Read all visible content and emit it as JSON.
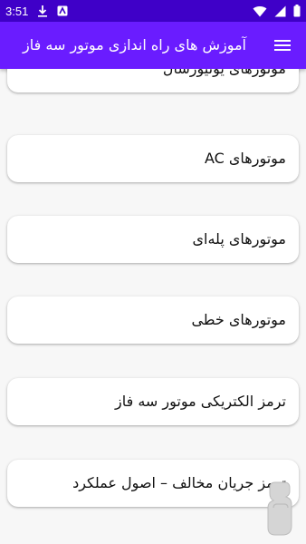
{
  "status_bar": {
    "time": "3:51",
    "icons": [
      "download-icon",
      "app-badge-icon",
      "wifi-icon",
      "signal-icon",
      "battery-icon"
    ]
  },
  "app_bar": {
    "title": "آموزش های راه اندازی موتور سه فاز",
    "menu_icon": "menu-icon"
  },
  "list": {
    "items": [
      {
        "label": "موتورهای یونیورسال"
      },
      {
        "label": "موتورهای AC"
      },
      {
        "label": "موتورهای پله‌ای"
      },
      {
        "label": "موتورهای خطی"
      },
      {
        "label": "ترمز الکتریکی موتور سه فاز"
      },
      {
        "label": "ترمز جریان مخالف – اصول عملکرد"
      }
    ]
  },
  "colors": {
    "status_bar": "#3f00c8",
    "app_bar": "#6a1cff",
    "background": "#f7f7f7",
    "card": "#ffffff"
  }
}
